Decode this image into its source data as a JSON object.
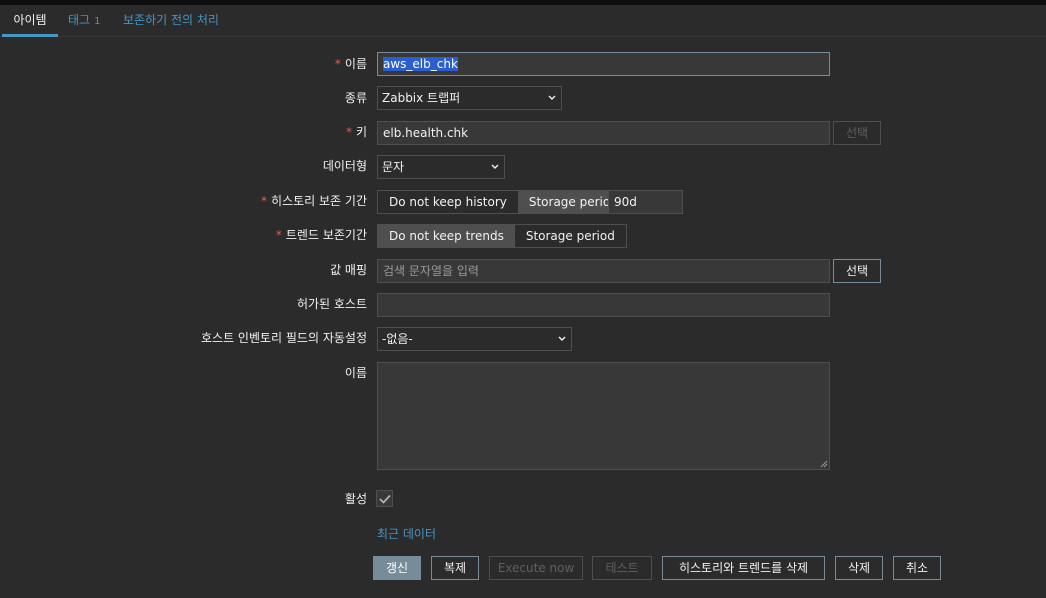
{
  "tabs": [
    {
      "label": "아이템"
    },
    {
      "label": "태그",
      "count": "1"
    },
    {
      "label": "보존하기 전의 처리"
    }
  ],
  "form": {
    "name": {
      "label": "이름",
      "value": "aws_elb_chk"
    },
    "type": {
      "label": "종류",
      "value": "Zabbix 트랩퍼"
    },
    "key": {
      "label": "키",
      "value": "elb.health.chk",
      "select_label": "선택"
    },
    "value_type": {
      "label": "데이터형",
      "value": "문자"
    },
    "history": {
      "label": "히스토리 보존 기간",
      "option1": "Do not keep history",
      "option2": "Storage period",
      "value": "90d"
    },
    "trends": {
      "label": "트렌드 보존기간",
      "option1": "Do not keep trends",
      "option2": "Storage period"
    },
    "value_mapping": {
      "label": "값 매핑",
      "placeholder": "검색 문자열을 입력",
      "select_label": "선택"
    },
    "allowed_hosts": {
      "label": "허가된 호스트",
      "value": ""
    },
    "inventory": {
      "label": "호스트 인벤토리 필드의 자동설정",
      "value": "-없음-"
    },
    "description": {
      "label": "이름",
      "value": ""
    },
    "enabled": {
      "label": "활성",
      "checked": true
    },
    "latest_data_link": "최근 데이터"
  },
  "buttons": {
    "update": "갱신",
    "clone": "복제",
    "execute_now": "Execute now",
    "test": "테스트",
    "clear_history": "히스토리와 트렌드를 삭제",
    "delete": "삭제",
    "cancel": "취소"
  },
  "colors": {
    "background": "#2b2b2b",
    "accent": "#4796c4",
    "required": "#e45959",
    "primary_button": "#768d99",
    "selection": "#2a5fd1"
  }
}
